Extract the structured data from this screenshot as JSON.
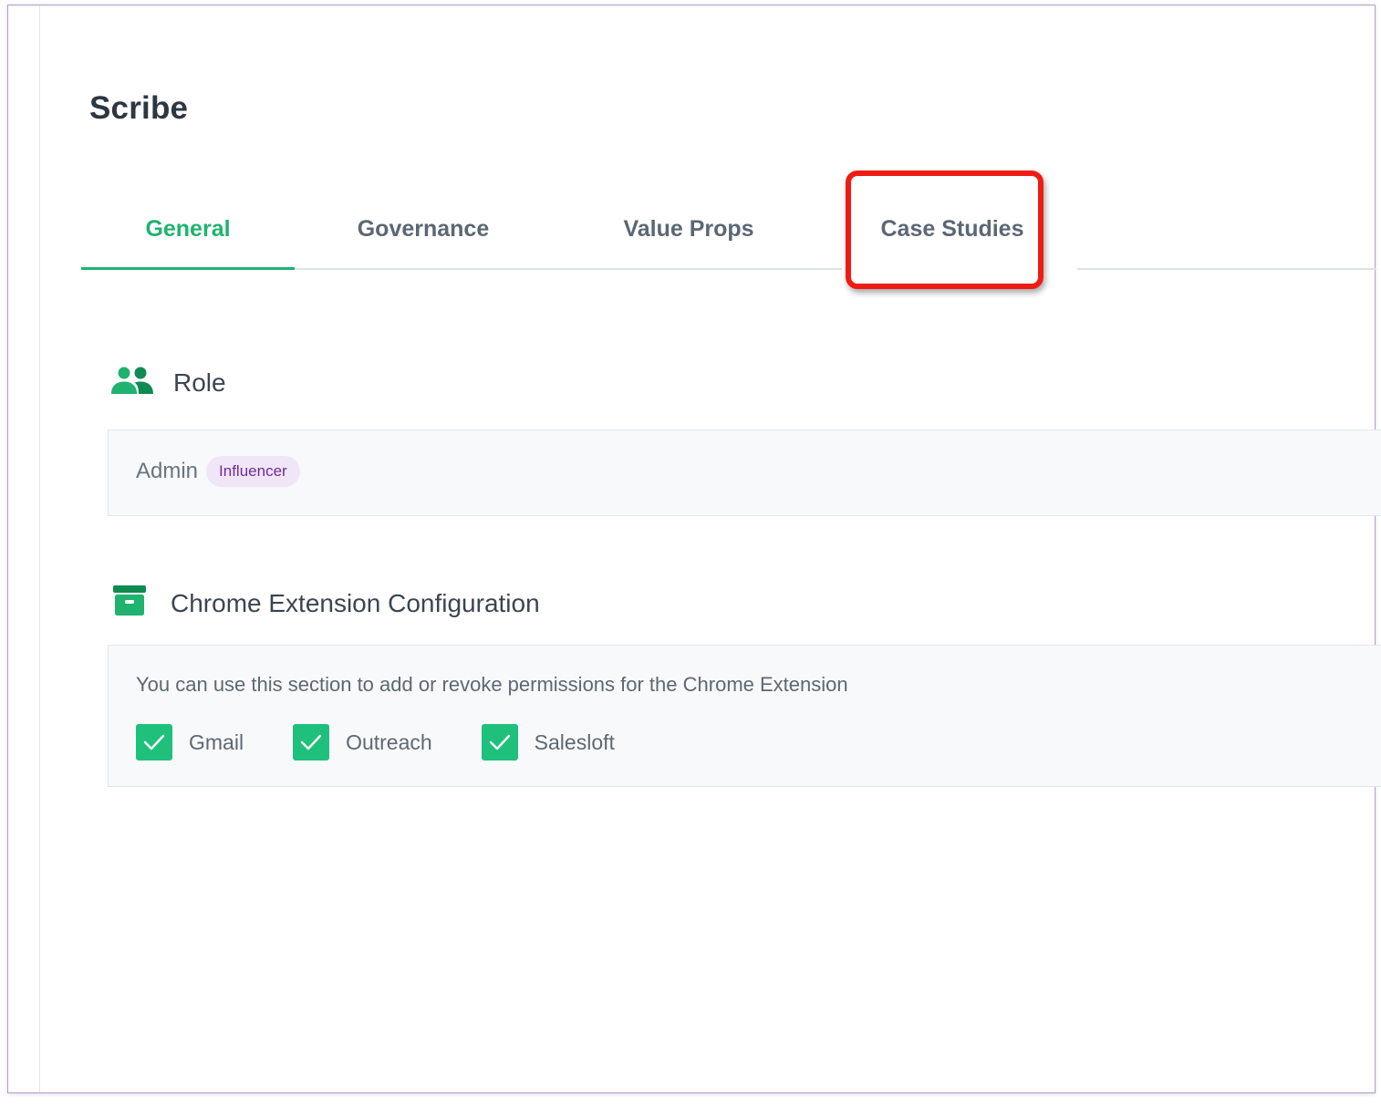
{
  "page": {
    "title": "Scribe"
  },
  "tabs": [
    {
      "label": "General",
      "active": true
    },
    {
      "label": "Governance",
      "active": false
    },
    {
      "label": "Value Props",
      "active": false
    },
    {
      "label": "Case Studies",
      "active": false,
      "highlighted": true
    }
  ],
  "role": {
    "icon": "people-icon",
    "title": "Role",
    "name": "Admin",
    "badge": "Influencer"
  },
  "chrome_extension": {
    "icon": "archive-box-icon",
    "title": "Chrome Extension Configuration",
    "description": "You can use this section to add or revoke permissions for the Chrome Extension",
    "permissions": [
      {
        "label": "Gmail",
        "checked": true
      },
      {
        "label": "Outreach",
        "checked": true
      },
      {
        "label": "Salesloft",
        "checked": true
      }
    ]
  },
  "colors": {
    "accent": "#1fb36f",
    "checkbox": "#1fc07b",
    "badge_bg": "#f1e6f8",
    "badge_text": "#6e2b9b",
    "highlight": "#ee1c14"
  }
}
